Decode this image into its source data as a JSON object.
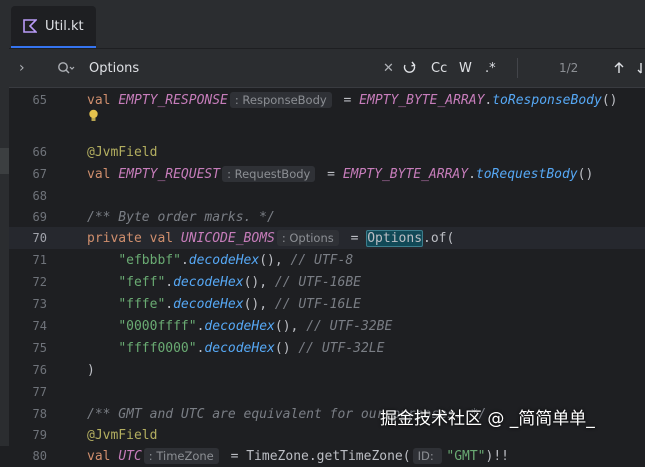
{
  "tab": {
    "label": "Util.kt"
  },
  "find": {
    "query": "Options",
    "match_count": "1/2",
    "match_case_label": "Cc",
    "words_label": "W",
    "regex_label": ".*"
  },
  "lines": [
    {
      "num": "65",
      "tokens": [
        [
          "kw",
          "val "
        ],
        [
          "const",
          "EMPTY_RESPONSE"
        ],
        [
          "hint",
          ": ResponseBody"
        ],
        [
          "plain",
          " = "
        ],
        [
          "const",
          "EMPTY_BYTE_ARRAY"
        ],
        [
          "plain",
          "."
        ],
        [
          "fn",
          "toResponseBody"
        ],
        [
          "plain",
          "()"
        ]
      ]
    },
    {
      "num": "",
      "tokens": []
    },
    {
      "num": "66",
      "tokens": [
        [
          "ann",
          "@JvmField"
        ]
      ]
    },
    {
      "num": "67",
      "tokens": [
        [
          "kw",
          "val "
        ],
        [
          "const",
          "EMPTY_REQUEST"
        ],
        [
          "hint",
          ": RequestBody"
        ],
        [
          "plain",
          " = "
        ],
        [
          "const",
          "EMPTY_BYTE_ARRAY"
        ],
        [
          "plain",
          "."
        ],
        [
          "fn",
          "toRequestBody"
        ],
        [
          "plain",
          "()"
        ]
      ]
    },
    {
      "num": "68",
      "tokens": []
    },
    {
      "num": "69",
      "tokens": [
        [
          "cmt",
          "/** Byte order marks. */"
        ]
      ]
    },
    {
      "num": "70",
      "current": true,
      "tokens": [
        [
          "kw",
          "private val "
        ],
        [
          "const",
          "UNICODE_BOMS"
        ],
        [
          "hint",
          ": Options"
        ],
        [
          "plain",
          " = "
        ],
        [
          "match",
          "Options"
        ],
        [
          "plain",
          "."
        ],
        [
          "plain",
          "of("
        ]
      ]
    },
    {
      "num": "71",
      "tokens": [
        [
          "plain",
          "    "
        ],
        [
          "str",
          "\"efbbbf\""
        ],
        [
          "plain",
          "."
        ],
        [
          "fn",
          "decodeHex"
        ],
        [
          "plain",
          "(), "
        ],
        [
          "cmt",
          "// UTF-8"
        ]
      ]
    },
    {
      "num": "72",
      "tokens": [
        [
          "plain",
          "    "
        ],
        [
          "str",
          "\"feff\""
        ],
        [
          "plain",
          "."
        ],
        [
          "fn",
          "decodeHex"
        ],
        [
          "plain",
          "(), "
        ],
        [
          "cmt",
          "// UTF-16BE"
        ]
      ]
    },
    {
      "num": "73",
      "tokens": [
        [
          "plain",
          "    "
        ],
        [
          "str",
          "\"fffe\""
        ],
        [
          "plain",
          "."
        ],
        [
          "fn",
          "decodeHex"
        ],
        [
          "plain",
          "(), "
        ],
        [
          "cmt",
          "// UTF-16LE"
        ]
      ]
    },
    {
      "num": "74",
      "tokens": [
        [
          "plain",
          "    "
        ],
        [
          "str",
          "\"0000ffff\""
        ],
        [
          "plain",
          "."
        ],
        [
          "fn",
          "decodeHex"
        ],
        [
          "plain",
          "(), "
        ],
        [
          "cmt",
          "// UTF-32BE"
        ]
      ]
    },
    {
      "num": "75",
      "tokens": [
        [
          "plain",
          "    "
        ],
        [
          "str",
          "\"ffff0000\""
        ],
        [
          "plain",
          "."
        ],
        [
          "fn",
          "decodeHex"
        ],
        [
          "plain",
          "() "
        ],
        [
          "cmt",
          "// UTF-32LE"
        ]
      ]
    },
    {
      "num": "76",
      "tokens": [
        [
          "plain",
          ")"
        ]
      ]
    },
    {
      "num": "77",
      "tokens": []
    },
    {
      "num": "78",
      "tokens": [
        [
          "cmt",
          "/** GMT and UTC are equivalent for our purposes. */"
        ]
      ]
    },
    {
      "num": "79",
      "tokens": [
        [
          "ann",
          "@JvmField"
        ]
      ]
    },
    {
      "num": "80",
      "tokens": [
        [
          "kw",
          "val "
        ],
        [
          "const",
          "UTC"
        ],
        [
          "hint",
          ": TimeZone"
        ],
        [
          "plain",
          " = TimeZone.getTimeZone("
        ],
        [
          "hint",
          "ID: "
        ],
        [
          "str",
          "\"GMT\""
        ],
        [
          "plain",
          ")!!"
        ]
      ]
    }
  ],
  "watermark": "掘金技术社区 @ _简简单单_",
  "colors": {
    "accent": "#3574f0",
    "match_bg": "#114957",
    "kotlin_logo": "#7f52ff"
  }
}
